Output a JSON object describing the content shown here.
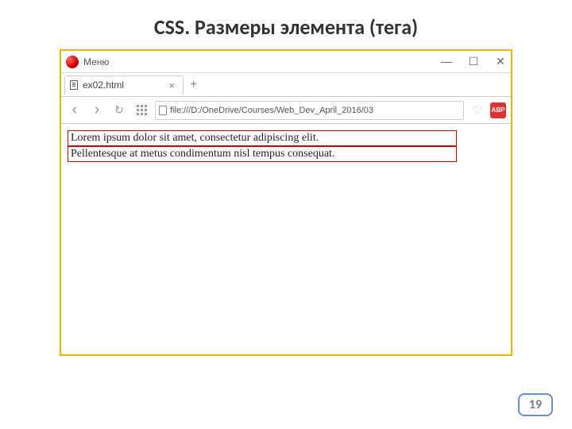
{
  "slide": {
    "title": "CSS. Размеры элемента (тега)",
    "page_number": "19"
  },
  "browser": {
    "menu_label": "Меню",
    "window_controls": {
      "min": "—",
      "max": "☐",
      "close": "✕"
    },
    "tab": {
      "title": "ex02.html",
      "close": "×"
    },
    "new_tab": "+",
    "nav": {
      "back": "‹",
      "forward": "›",
      "reload": "↻"
    },
    "url": "file:///D:/OneDrive/Courses/Web_Dev_April_2016/03",
    "heart": "♡",
    "abp": "ABP"
  },
  "page_content": {
    "line1": "Lorem ipsum dolor sit amet, consectetur adipiscing elit.",
    "line2": "Pellentesque at metus condimentum nisl tempus consequat."
  }
}
